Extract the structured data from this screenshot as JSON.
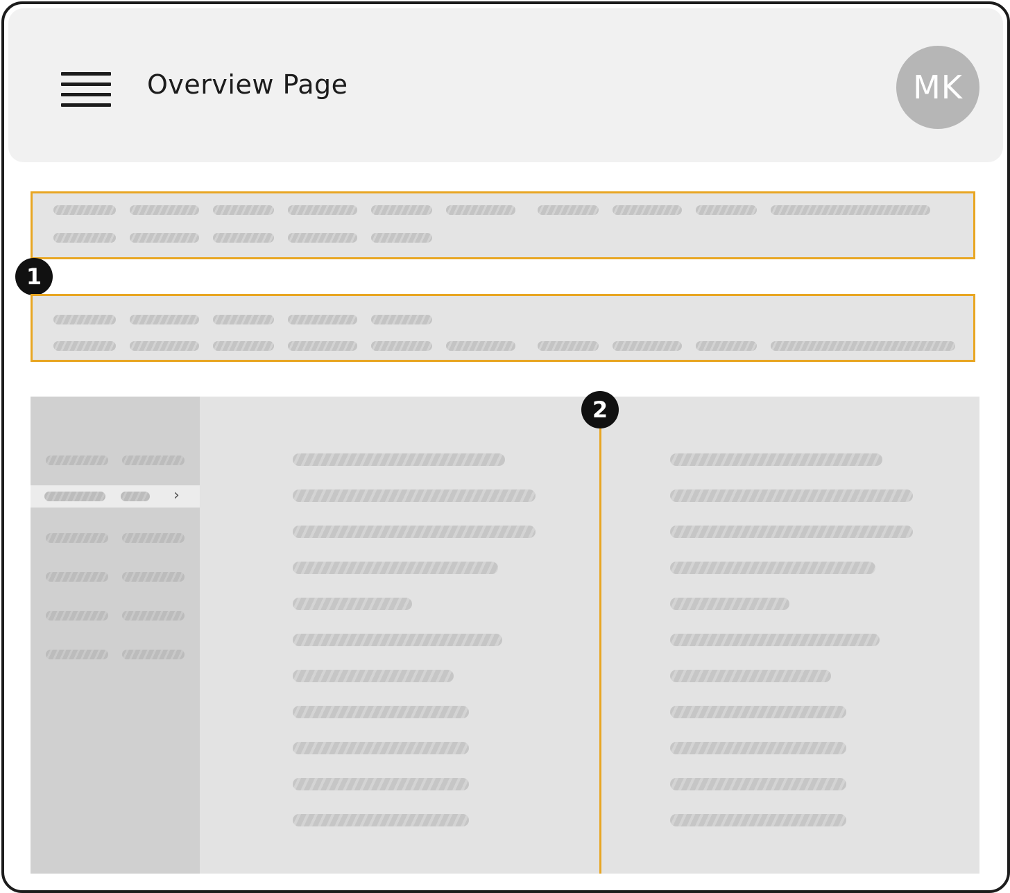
{
  "header": {
    "title": "Overview Page",
    "avatar_initials": "MK"
  },
  "markers": {
    "one": "1",
    "two": "2"
  },
  "colors": {
    "accent": "#e8a623",
    "header_bg": "#f1f1f1",
    "frame": "#1c1c1c",
    "avatar_bg": "#b6b6b6"
  },
  "sidebar": {
    "active_index": 1
  },
  "icons": [
    "hamburger-menu-icon",
    "chevron-right-icon"
  ]
}
